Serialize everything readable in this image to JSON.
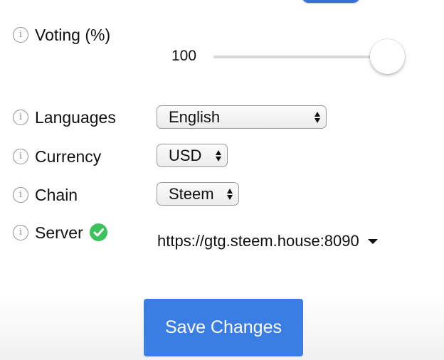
{
  "settings": {
    "voting": {
      "label": "Voting (%)",
      "value_text": "100",
      "value": 100,
      "max": 100
    },
    "languages": {
      "label": "Languages",
      "selected": "English"
    },
    "currency": {
      "label": "Currency",
      "selected": "USD"
    },
    "chain": {
      "label": "Chain",
      "selected": "Steem"
    },
    "server": {
      "label": "Server",
      "status": "connected",
      "status_icon": "check-circle-icon",
      "selected": "https://gtg.steem.house:8090"
    }
  },
  "actions": {
    "save_label": "Save Changes"
  },
  "icons": {
    "info": "info-icon",
    "info_glyph": "i"
  },
  "colors": {
    "primary": "#3a7ee4",
    "toggle": "#3b6fd8",
    "success": "#3cc25d",
    "info_icon": "#8f8f8f"
  }
}
